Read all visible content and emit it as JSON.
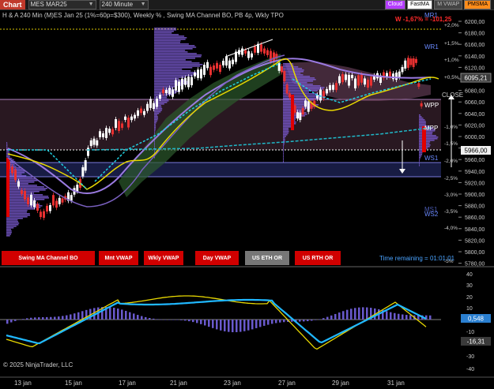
{
  "toolbar": {
    "chart_tab": "Chart",
    "instrument": "MES MAR25",
    "interval": "240 Minute",
    "buttons": [
      {
        "label": "Cloud",
        "bg": "#b43cff",
        "fg": "#ffffff"
      },
      {
        "label": "FastMA",
        "bg": "#ffffff",
        "fg": "#000000"
      },
      {
        "label": "M VWAP",
        "bg": "#444444",
        "fg": "#bbbbbb"
      },
      {
        "label": "PMSMA",
        "bg": "#ff8c1a",
        "fg": "#000000"
      }
    ]
  },
  "chart": {
    "title": "H & A 240 Min (M)ES Jan 25  (1%=60p=$300), Weekly % , Swing MA Channel BO, PB 4p, Wkly TPO",
    "pnl": "W -1,67% = -101,25",
    "time_remaining": "Time remaining = 01:01:01",
    "copyright": "© 2025 NinjaTrader, LLC",
    "price_ticks": [
      "6200,00",
      "6180,00",
      "6160,00",
      "6140,00",
      "6120,00",
      "6100,00",
      "6080,00",
      "6060,00",
      "6040,00",
      "6020,00",
      "6000,00",
      "5980,00",
      "5960,00",
      "5940,00",
      "5920,00",
      "5900,00",
      "5880,00",
      "5860,00",
      "5840,00",
      "5820,00",
      "5800,00",
      "5780,00"
    ],
    "current_price": "6095,21",
    "last_price": "5966,00",
    "pct_labels": [
      "+2,0%",
      "+1,5%",
      "+1,0%",
      "+0,5%",
      "-1,0%",
      "-1,5%",
      "-2,0%",
      "-2,5%",
      "-3,0%",
      "-3,5%",
      "-4,0%",
      "-5%"
    ],
    "level_labels": [
      "MR1",
      "WR1",
      "CLOSE",
      "WPP",
      "MPP",
      "WS1",
      "WS2",
      "MS1"
    ],
    "bottom_buttons": [
      {
        "label": "Swing MA Channel BO",
        "bg": "#d10000"
      },
      {
        "label": "Mnt VWAP",
        "bg": "#d10000"
      },
      {
        "label": "Wkly VWAP",
        "bg": "#d10000"
      },
      {
        "label": "Day VWAP",
        "bg": "#d10000"
      },
      {
        "label": "US ETH OR",
        "bg": "#777777"
      },
      {
        "label": "US RTH OR",
        "bg": "#d10000"
      }
    ]
  },
  "oscillator": {
    "ticks": [
      "40",
      "30",
      "20",
      "10",
      "-10",
      "-20",
      "-30",
      "-40"
    ],
    "value1": "0,548",
    "value2": "-16,31"
  },
  "x_axis": [
    "13 jan",
    "15 jan",
    "17 jan",
    "21 jan",
    "23 jan",
    "27 jan",
    "29 jan",
    "31 jan"
  ]
}
